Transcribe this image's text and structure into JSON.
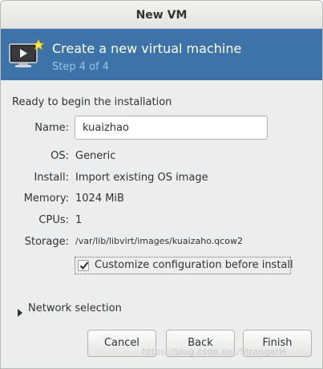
{
  "window": {
    "title": "New VM"
  },
  "banner": {
    "title": "Create a new virtual machine",
    "step": "Step 4 of 4",
    "icon": "vm-monitor-icon"
  },
  "summary": {
    "heading": "Ready to begin the installation",
    "name_label": "Name:",
    "name_value": "kuaizhao",
    "os_label": "OS:",
    "os_value": "Generic",
    "install_label": "Install:",
    "install_value": "Import existing OS image",
    "memory_label": "Memory:",
    "memory_value": "1024 MiB",
    "cpus_label": "CPUs:",
    "cpus_value": "1",
    "storage_label": "Storage:",
    "storage_value": "/var/lib/libvirt/images/kuaizaho.qcow2"
  },
  "customize": {
    "label": "Customize configuration before install",
    "checked": true
  },
  "network": {
    "label": "Network selection"
  },
  "buttons": {
    "cancel": "Cancel",
    "back": "Back",
    "finish": "Finish"
  },
  "watermark": "https://blog.csdn.net/StrangerH",
  "colors": {
    "banner": "#3c73a9",
    "step_text": "#9cc3e6"
  }
}
